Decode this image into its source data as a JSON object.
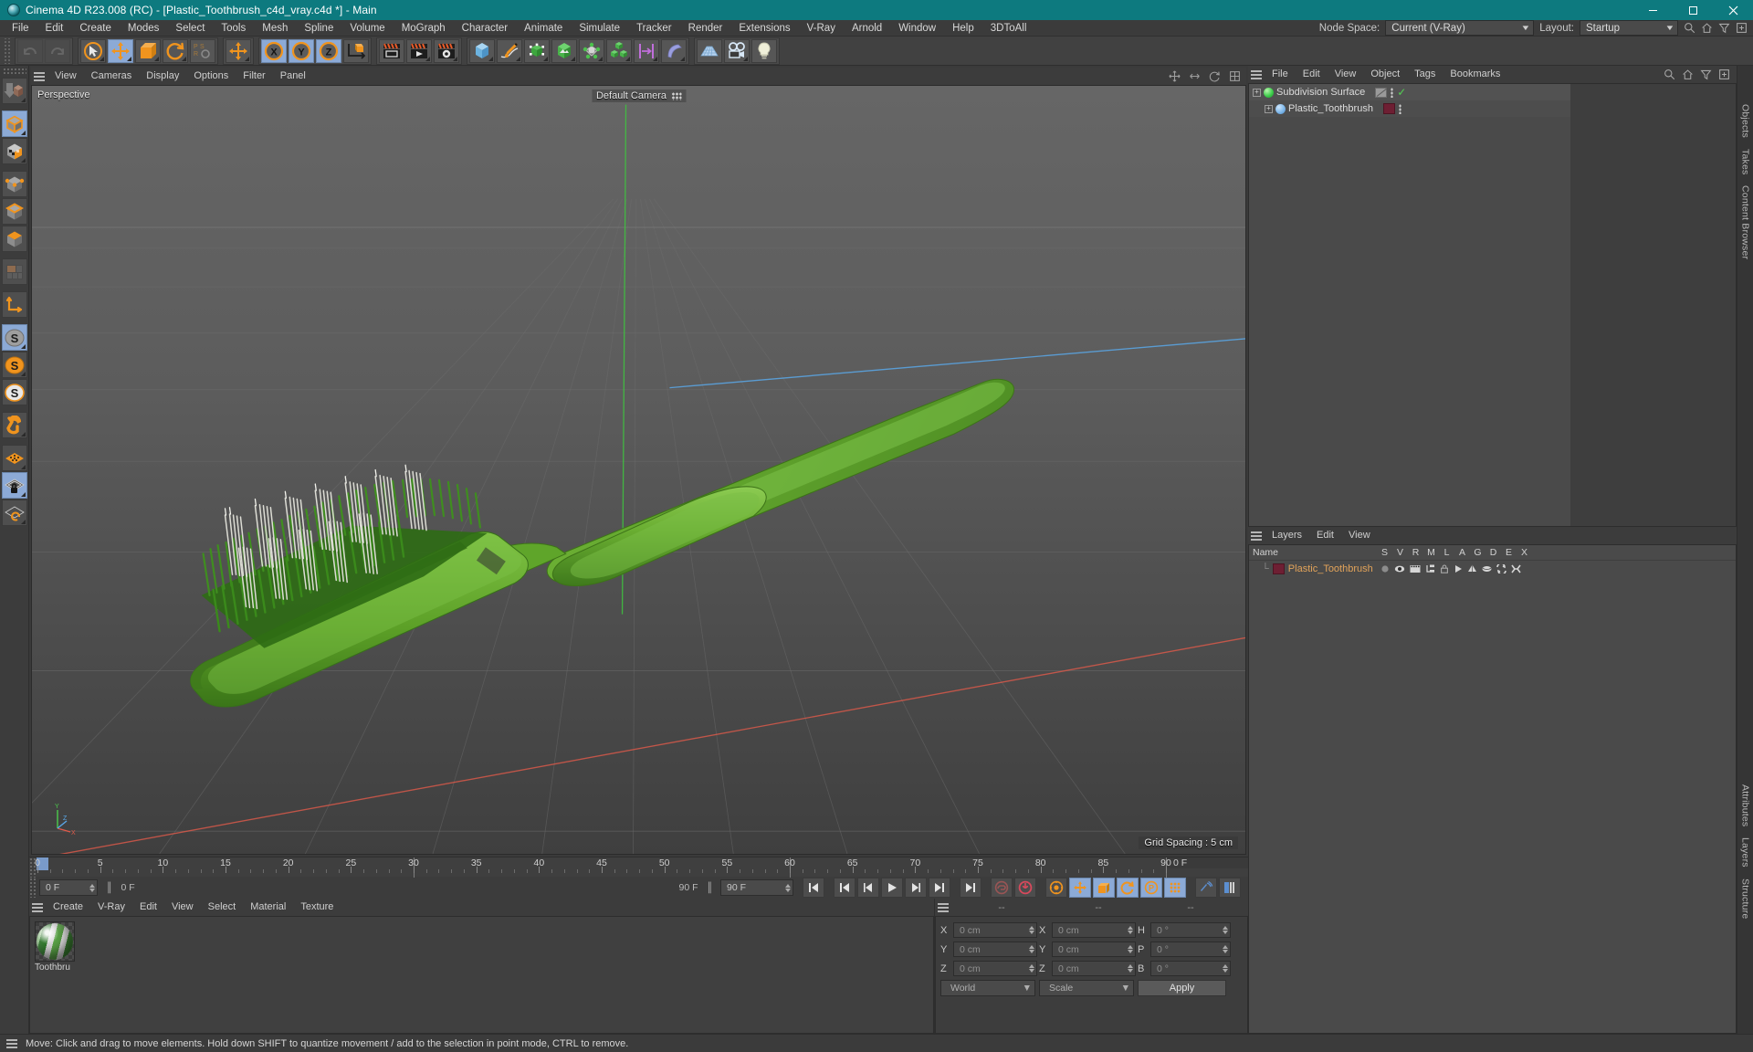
{
  "titlebar": {
    "title": "Cinema 4D R23.008 (RC) - [Plastic_Toothbrush_c4d_vray.c4d *] - Main",
    "minimize": "–",
    "maximize": "❐",
    "close": "✕"
  },
  "menubar": {
    "items": [
      "File",
      "Edit",
      "Create",
      "Modes",
      "Select",
      "Tools",
      "Mesh",
      "Spline",
      "Volume",
      "MoGraph",
      "Character",
      "Animate",
      "Simulate",
      "Tracker",
      "Render",
      "Extensions",
      "V-Ray",
      "Arnold",
      "Window",
      "Help",
      "3DToAll"
    ],
    "node_space_label": "Node Space:",
    "node_space_value": "Current (V-Ray)",
    "layout_label": "Layout:",
    "layout_value": "Startup"
  },
  "viewport": {
    "menu": [
      "View",
      "Cameras",
      "Display",
      "Options",
      "Filter",
      "Panel"
    ],
    "projection_label": "Perspective",
    "camera_label": "Default Camera",
    "grid_spacing": "Grid Spacing : 5 cm",
    "axis_x": "X",
    "axis_y": "Y",
    "axis_z": "Z"
  },
  "timeline": {
    "ticks": [
      0,
      5,
      10,
      15,
      20,
      25,
      30,
      35,
      40,
      45,
      50,
      55,
      60,
      65,
      70,
      75,
      80,
      85,
      90
    ],
    "current_frame": "0 F",
    "current_frame_field": "0 F",
    "preview_start": "0 F",
    "preview_end": "90 F",
    "end_frame": "90 F",
    "right_frame": "0 F"
  },
  "material_manager": {
    "menu": [
      "Create",
      "V-Ray",
      "Edit",
      "View",
      "Select",
      "Material",
      "Texture"
    ],
    "materials": [
      {
        "name": "Toothbru"
      }
    ]
  },
  "coordinates": {
    "header_left": "--",
    "header_mid": "--",
    "header_right": "--",
    "rows": [
      {
        "pos_axis": "X",
        "pos_value": "0 cm",
        "size_axis": "X",
        "size_value": "0 cm",
        "rot_axis": "H",
        "rot_value": "0 °"
      },
      {
        "pos_axis": "Y",
        "pos_value": "0 cm",
        "size_axis": "Y",
        "size_value": "0 cm",
        "rot_axis": "P",
        "rot_value": "0 °"
      },
      {
        "pos_axis": "Z",
        "pos_value": "0 cm",
        "size_axis": "Z",
        "size_value": "0 cm",
        "rot_axis": "B",
        "rot_value": "0 °"
      }
    ],
    "coord_system": "World",
    "transform_mode": "Scale",
    "apply_label": "Apply"
  },
  "object_manager": {
    "menu": [
      "File",
      "Edit",
      "View",
      "Object",
      "Tags",
      "Bookmarks"
    ],
    "items": [
      {
        "name": "Subdivision Surface",
        "depth": 0
      },
      {
        "name": "Plastic_Toothbrush",
        "depth": 1
      }
    ]
  },
  "layer_manager": {
    "menu": [
      "Layers",
      "Edit",
      "View"
    ],
    "columns": [
      "Name",
      "S",
      "V",
      "R",
      "M",
      "L",
      "A",
      "G",
      "D",
      "E",
      "X"
    ],
    "rows": [
      {
        "name": "Plastic_Toothbrush"
      }
    ]
  },
  "edge_tabs": [
    "Objects",
    "Takes",
    "Content Browser",
    "Attributes",
    "Layers",
    "Structure"
  ],
  "statusbar": {
    "message": "Move: Click and drag to move elements. Hold down SHIFT to quantize movement / add to the selection in point mode, CTRL to remove."
  },
  "colors": {
    "title_bg": "#0d7a7f",
    "accent_orange": "#f0941e",
    "active_blue": "#8caad6",
    "model_green": "#6aab2e",
    "layer_swatch": "#6e1f33"
  }
}
